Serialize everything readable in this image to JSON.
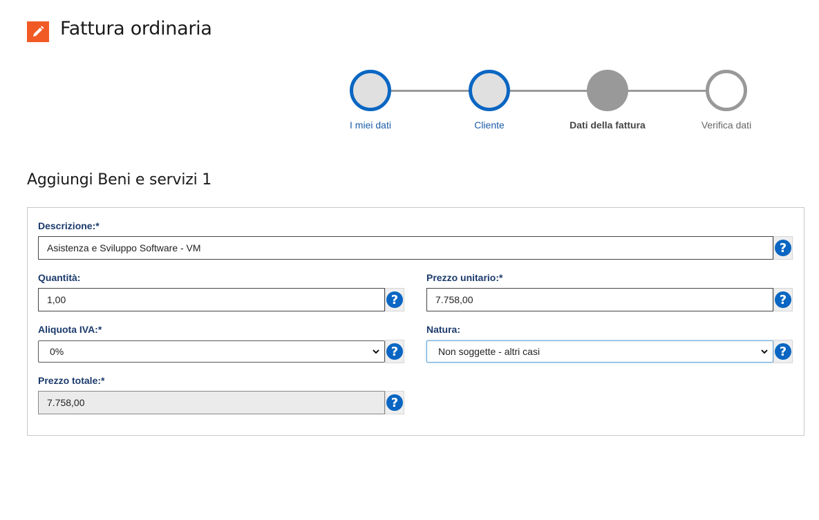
{
  "page": {
    "title": "Fattura ordinaria"
  },
  "stepper": {
    "steps": [
      {
        "label": "I miei dati",
        "state": "done"
      },
      {
        "label": "Cliente",
        "state": "done"
      },
      {
        "label": "Dati della fattura",
        "state": "current"
      },
      {
        "label": "Verifica dati",
        "state": "todo"
      }
    ]
  },
  "section": {
    "title": "Aggiungi Beni e servizi 1"
  },
  "form": {
    "descrizione": {
      "label": "Descrizione:*",
      "value": "Asistenza e Sviluppo Software - VM"
    },
    "quantita": {
      "label": "Quantità:",
      "value": "1,00"
    },
    "prezzo_unitario": {
      "label": "Prezzo unitario:*",
      "value": "7.758,00"
    },
    "aliquota_iva": {
      "label": "Aliquota IVA:*",
      "selected": "0%"
    },
    "natura": {
      "label": "Natura:",
      "selected": "Non soggette - altri casi"
    },
    "prezzo_totale": {
      "label": "Prezzo totale:*",
      "value": "7.758,00"
    },
    "help_glyph": "?"
  },
  "colors": {
    "accent": "#0a66c2",
    "title_icon_bg": "#f15a24",
    "label": "#1b3a6b",
    "step_inactive": "#999999"
  },
  "icons": {
    "title": "pencil-icon",
    "help": "help-icon",
    "select": "chevron-down-icon"
  }
}
